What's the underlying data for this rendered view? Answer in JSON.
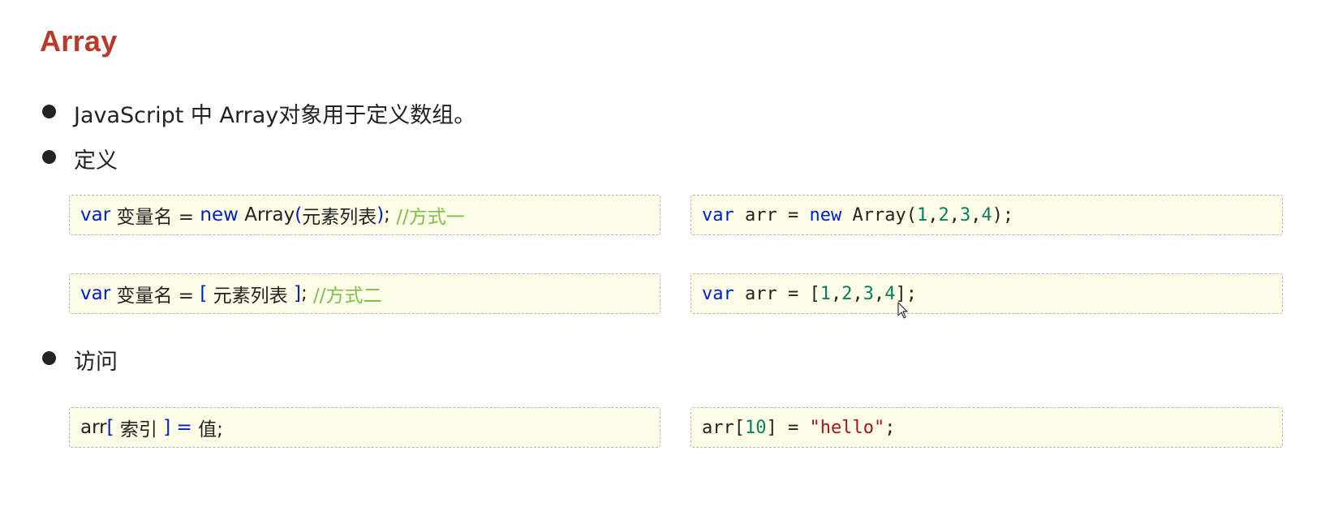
{
  "title": "Array",
  "bullets": [
    {
      "text": "JavaScript 中 Array对象用于定义数组。"
    },
    {
      "text": "定义"
    },
    {
      "text": "访问"
    }
  ],
  "define": {
    "syntax1": {
      "kw_var": "var",
      "name": " 变量名 = ",
      "kw_new": "new",
      "ctor": " Array",
      "open": "(",
      "args": "元素列表",
      "close": ")",
      "semi": "; ",
      "comment": "//方式一"
    },
    "syntax2": {
      "kw_var": "var",
      "name": " 变量名 = ",
      "open": "[",
      "args": " 元素列表 ",
      "close": "]",
      "semi": "; ",
      "comment": "//方式二"
    },
    "example1": {
      "kw_var": "var",
      "mid": " arr = ",
      "kw_new": "new",
      "ctor": " Array(",
      "n1": "1",
      "c1": ",",
      "n2": "2",
      "c2": ",",
      "n3": "3",
      "c3": ",",
      "n4": "4",
      "end": ");"
    },
    "example2": {
      "kw_var": "var",
      "mid": " arr = [",
      "n1": "1",
      "c1": ",",
      "n2": "2",
      "c2": ",",
      "n3": "3",
      "c3": ",",
      "n4": "4",
      "end": "];"
    }
  },
  "access": {
    "syntax": {
      "arr": "arr",
      "open": "[",
      "index": " 索引 ",
      "close": "]",
      "eq": " = ",
      "value": "值;"
    },
    "example": {
      "arr": "arr[",
      "index": "10",
      "mid": "] = ",
      "str": "\"hello\"",
      "end": ";"
    }
  },
  "colors": {
    "title": "#b83a2b",
    "keyword": "#0020c8",
    "number": "#0a7d5a",
    "string": "#a31515",
    "comment": "#7cbf4a",
    "code_background": "#fefde8"
  },
  "icons": {
    "cursor": "mouse-pointer-icon"
  }
}
